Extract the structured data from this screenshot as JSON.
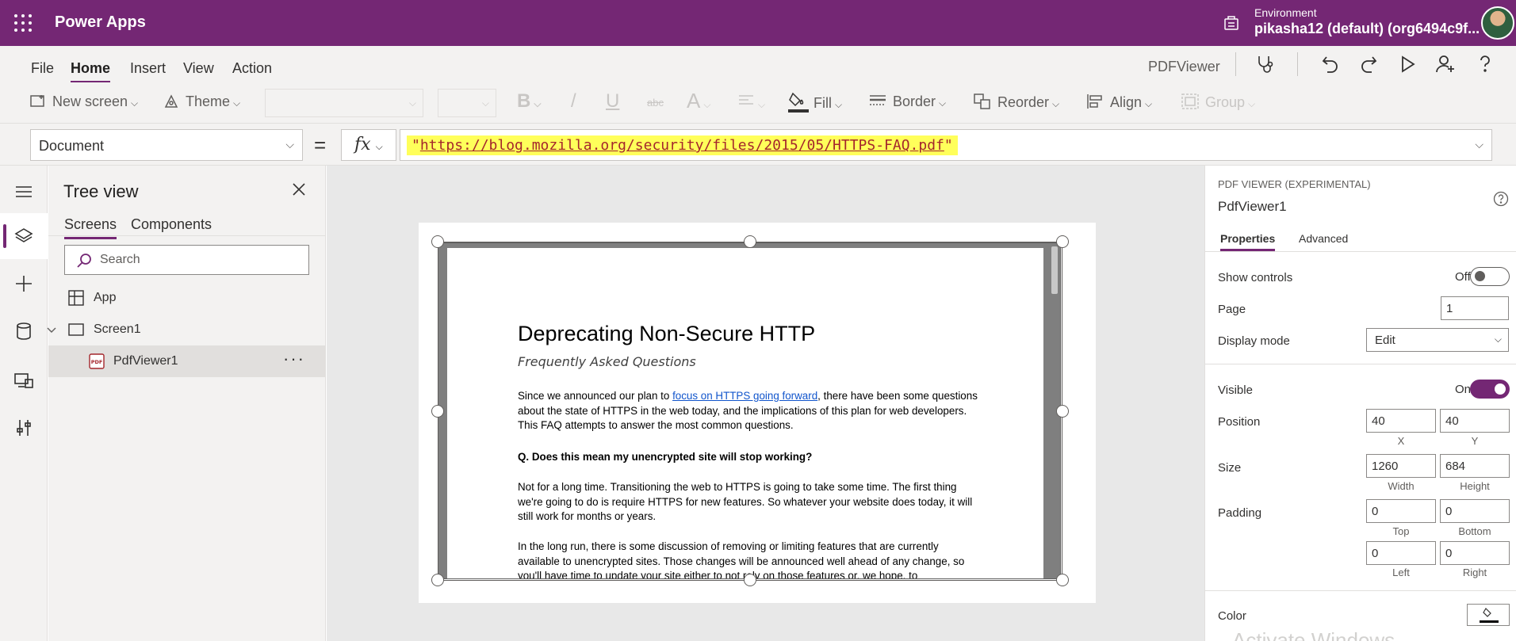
{
  "header": {
    "app_title": "Power Apps",
    "env_label": "Environment",
    "env_value": "pikasha12 (default) (org6494c9f..."
  },
  "menu": {
    "items": [
      "File",
      "Home",
      "Insert",
      "View",
      "Action"
    ],
    "active": "Home",
    "app_name": "PDFViewer"
  },
  "ribbon": {
    "new_screen": "New screen",
    "theme": "Theme",
    "bold": "B",
    "italic": "/",
    "underline": "U",
    "strike": "abc",
    "font_size_icon": "A",
    "fill": "Fill",
    "border": "Border",
    "reorder": "Reorder",
    "align": "Align",
    "group": "Group"
  },
  "formula_bar": {
    "property": "Document",
    "equals": "=",
    "fx": "fx",
    "formula_open_quote": "\"",
    "formula_url": "https://blog.mozilla.org/security/files/2015/05/HTTPS-FAQ.pdf",
    "formula_close_quote": "\""
  },
  "tree_view": {
    "title": "Tree view",
    "tabs": [
      "Screens",
      "Components"
    ],
    "search_placeholder": "Search",
    "items": [
      {
        "label": "App"
      },
      {
        "label": "Screen1"
      },
      {
        "label": "PdfViewer1"
      }
    ],
    "more": "···"
  },
  "pdf": {
    "title": "Deprecating Non-Secure HTTP",
    "subtitle": "Frequently Asked Questions",
    "p1_before": "Since we announced our plan to ",
    "p1_link": "focus on HTTPS going forward",
    "p1_after": ", there have been some questions about the state of HTTPS in the web today, and the implications of this plan for web developers.  This FAQ attempts to answer the most common questions.",
    "q1": "Q. Does this mean my unencrypted site will stop working?",
    "p2": "Not for a long time.  Transitioning the web to HTTPS is going to take some time.  The first thing we're going to do is require HTTPS for new features.  So whatever your website does today, it will still work for months or years.",
    "p3": "In the long run, there is some discussion of removing or limiting features that are currently available to unencrypted sites.  Those changes will be announced well ahead of any change, so you'll have time to update your site either to not rely on those features or, we hope, to"
  },
  "properties": {
    "kind": "PDF VIEWER (EXPERIMENTAL)",
    "name": "PdfViewer1",
    "tabs": [
      "Properties",
      "Advanced"
    ],
    "show_controls_label": "Show controls",
    "show_controls_state": "Off",
    "page_label": "Page",
    "page_value": "1",
    "display_mode_label": "Display mode",
    "display_mode_value": "Edit",
    "visible_label": "Visible",
    "visible_state": "On",
    "position_label": "Position",
    "position_x": "40",
    "position_y": "40",
    "x_cap": "X",
    "y_cap": "Y",
    "size_label": "Size",
    "width": "1260",
    "height": "684",
    "width_cap": "Width",
    "height_cap": "Height",
    "padding_label": "Padding",
    "pad_top": "0",
    "pad_bottom": "0",
    "pad_left": "0",
    "pad_right": "0",
    "top_cap": "Top",
    "bottom_cap": "Bottom",
    "left_cap": "Left",
    "right_cap": "Right",
    "color_label": "Color",
    "watermark": "Activate Windows"
  },
  "colors": {
    "brand": "#742774",
    "formula_highlight": "#ffff5a",
    "link": "#1155cc"
  }
}
